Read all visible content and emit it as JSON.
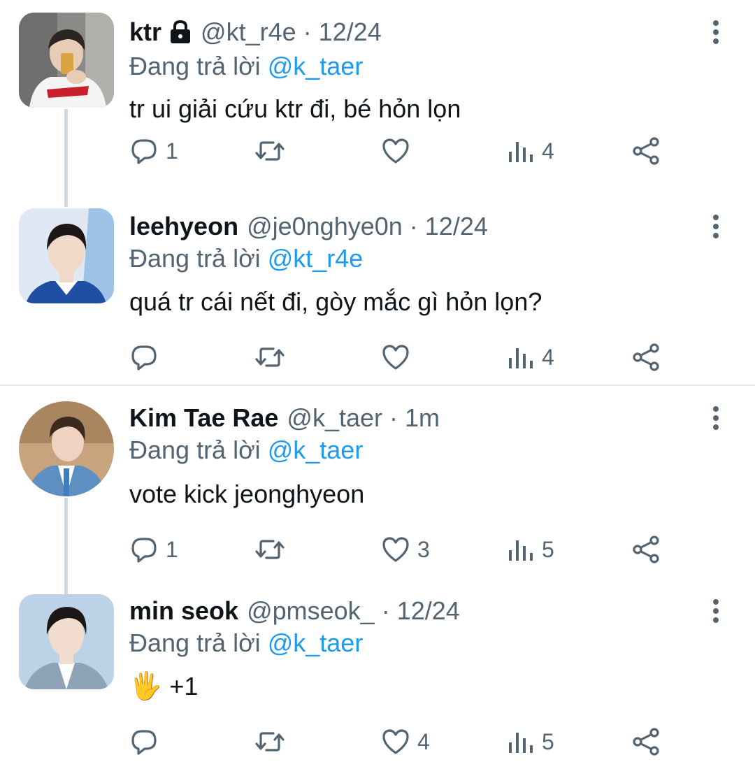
{
  "colors": {
    "text": "#0f1419",
    "secondary": "#536471",
    "mention": "#1d9bf0",
    "thread_line": "#cfd9de",
    "divider": "#e6e9eb"
  },
  "tweets": [
    {
      "name": "ktr",
      "handle": "@kt_r4e",
      "separator": "·",
      "time": "12/24",
      "reply_prefix": "Đang trả lời",
      "reply_to": "@k_taer",
      "text": "tr ui giải cứu ktr đi, bé hỏn lọn",
      "replies": "1",
      "retweets": "",
      "likes": "",
      "views": "4",
      "locked": true
    },
    {
      "name": "leehyeon",
      "handle": "@je0nghye0n",
      "separator": "·",
      "time": "12/24",
      "reply_prefix": "Đang trả lời",
      "reply_to": "@kt_r4e",
      "text": "quá tr cái nết đi, gòy mắc gì hỏn lọn?",
      "replies": "",
      "retweets": "",
      "likes": "",
      "views": "4"
    },
    {
      "name": "Kim Tae Rae",
      "handle": "@k_taer",
      "separator": "·",
      "time": "1m",
      "reply_prefix": "Đang trả lời",
      "reply_to": "@k_taer",
      "text": "vote kick jeonghyeon",
      "replies": "1",
      "retweets": "",
      "likes": "3",
      "views": "5"
    },
    {
      "name": "min seok",
      "handle": "@pmseok_",
      "separator": "·",
      "time": "12/24",
      "reply_prefix": "Đang trả lời",
      "reply_to": "@k_taer",
      "text_emoji": "🖐",
      "text": "+1",
      "replies": "",
      "retweets": "",
      "likes": "4",
      "views": "5"
    }
  ],
  "icons": {
    "reply": "reply-icon",
    "retweet": "retweet-icon",
    "like": "heart-icon",
    "views": "views-icon",
    "share": "share-icon",
    "more": "more-vertical-icon",
    "lock": "lock-icon"
  }
}
